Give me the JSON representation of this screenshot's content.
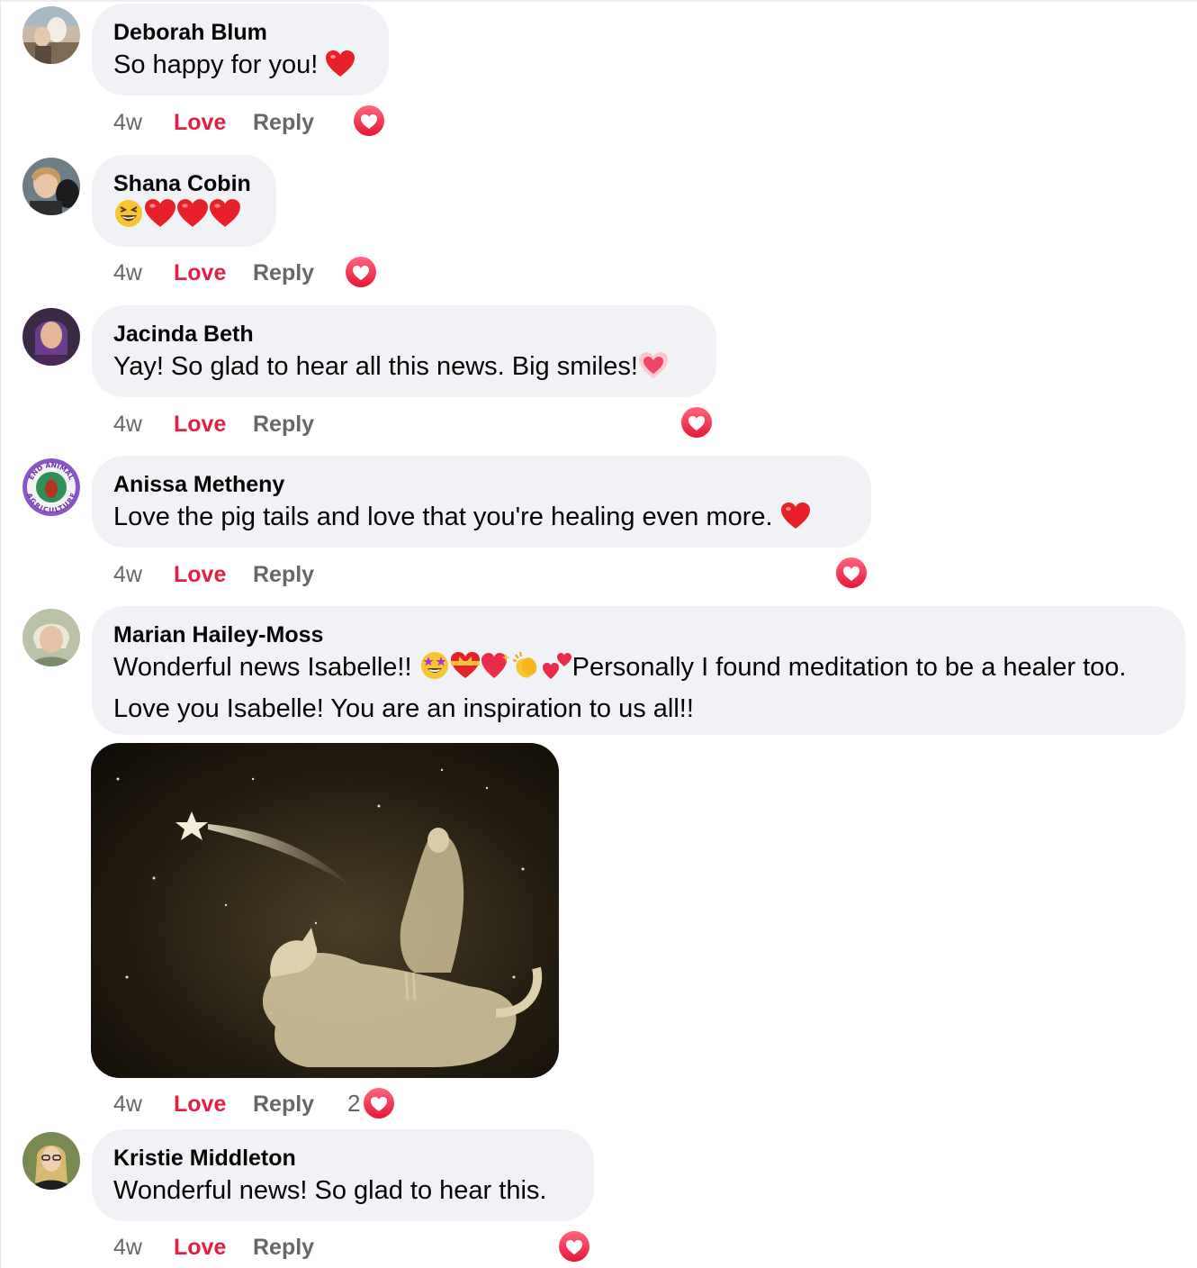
{
  "colors": {
    "bubble": "#f0f2f5",
    "love": "#e41e3f",
    "meta": "#65676b",
    "heart_reaction": "#f33e58"
  },
  "comments": [
    {
      "author": "Deborah Blum",
      "text": "So happy for you!",
      "emoji_suffix": [
        "heart"
      ],
      "time": "4w",
      "love_label": "Love",
      "reply_label": "Reply",
      "reaction": "heart-reaction",
      "reaction_count": ""
    },
    {
      "author": "Shana Cobin",
      "text": "",
      "emoji_suffix": [
        "laughing-face",
        "heart",
        "heart",
        "heart"
      ],
      "time": "4w",
      "love_label": "Love",
      "reply_label": "Reply",
      "reaction": "heart-reaction",
      "reaction_count": ""
    },
    {
      "author": "Jacinda Beth",
      "text": "Yay! So glad to hear all this news. Big smiles!",
      "emoji_suffix": [
        "growing-heart"
      ],
      "time": "4w",
      "love_label": "Love",
      "reply_label": "Reply",
      "reaction": "heart-reaction",
      "reaction_count": ""
    },
    {
      "author": "Anissa Metheny",
      "text": "Love the pig tails and love that you're healing even more.",
      "emoji_suffix": [
        "heart"
      ],
      "time": "4w",
      "love_label": "Love",
      "reply_label": "Reply",
      "reaction": "heart-reaction",
      "reaction_count": "",
      "avatar_text": [
        "END ANIMAL",
        "AGRICULTURE"
      ]
    },
    {
      "author": "Marian Hailey-Moss",
      "text_before": "Wonderful news Isabelle!!",
      "inline_emoji": [
        "star-struck",
        "heart-with-ribbon",
        "sparkling-heart",
        "clapping-hands",
        "two-hearts"
      ],
      "text_after": "Personally I found meditation to be a healer too. Love you Isabelle! You are an inspiration to us all!!",
      "attachment": "painting-girl-on-horse-shooting-star",
      "time": "4w",
      "love_label": "Love",
      "reply_label": "Reply",
      "reaction": "heart-reaction",
      "reaction_count": "2"
    },
    {
      "author": "Kristie Middleton",
      "text": "Wonderful news! So glad to hear this.",
      "emoji_suffix": [],
      "time": "4w",
      "love_label": "Love",
      "reply_label": "Reply",
      "reaction": "heart-reaction",
      "reaction_count": ""
    }
  ]
}
